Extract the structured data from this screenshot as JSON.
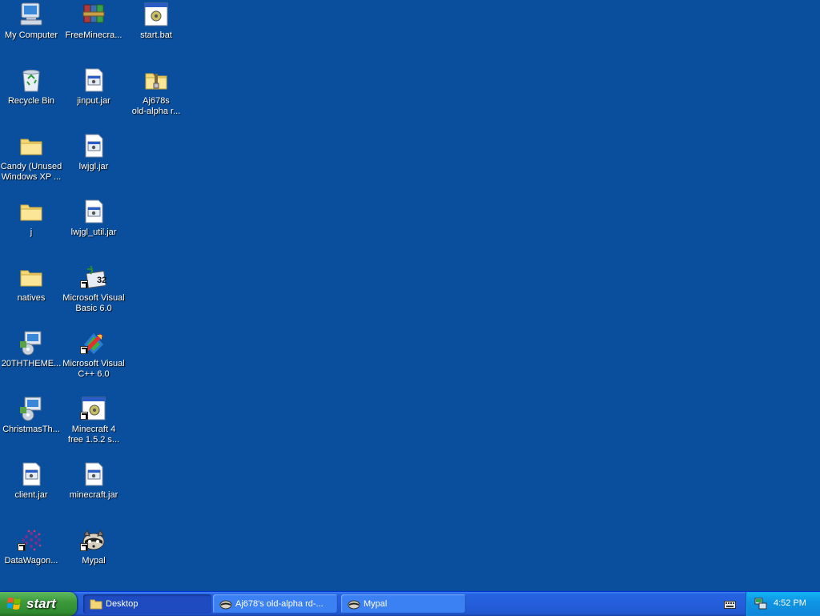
{
  "desktop": {
    "icons": [
      {
        "id": "my-computer",
        "label": "My Computer"
      },
      {
        "id": "recycle-bin",
        "label": "Recycle Bin"
      },
      {
        "id": "candy",
        "label": "Candy (Unused\nWindows XP ..."
      },
      {
        "id": "j",
        "label": "j"
      },
      {
        "id": "natives",
        "label": "natives"
      },
      {
        "id": "20themes",
        "label": "20THTHEME..."
      },
      {
        "id": "christmas",
        "label": "ChristmasTh..."
      },
      {
        "id": "client-jar",
        "label": "client.jar"
      },
      {
        "id": "datawagon",
        "label": "DataWagon..."
      },
      {
        "id": "freeminecraft",
        "label": "FreeMinecra..."
      },
      {
        "id": "jinput",
        "label": "jinput.jar"
      },
      {
        "id": "lwjgl",
        "label": "lwjgl.jar"
      },
      {
        "id": "lwjgl-util",
        "label": "lwjgl_util.jar"
      },
      {
        "id": "vb6",
        "label": "Microsoft Visual\nBasic 6.0"
      },
      {
        "id": "vcpp6",
        "label": "Microsoft Visual\nC++ 6.0"
      },
      {
        "id": "minecraft4free",
        "label": "Minecraft 4\nfree 1.5.2 s..."
      },
      {
        "id": "minecraft-jar",
        "label": "minecraft.jar"
      },
      {
        "id": "mypal",
        "label": "Mypal"
      },
      {
        "id": "start-bat",
        "label": "start.bat"
      },
      {
        "id": "aj678s",
        "label": "Aj678s\nold-alpha r..."
      }
    ]
  },
  "taskbar": {
    "start_label": "start",
    "tasks": [
      {
        "label": "Desktop",
        "icon": "folder-icon",
        "active": true
      },
      {
        "label": "Aj678's old-alpha rd-...",
        "icon": "raccoon-icon",
        "active": false
      },
      {
        "label": "Mypal",
        "icon": "raccoon-icon",
        "active": false
      }
    ],
    "clock": "4:52 PM"
  }
}
